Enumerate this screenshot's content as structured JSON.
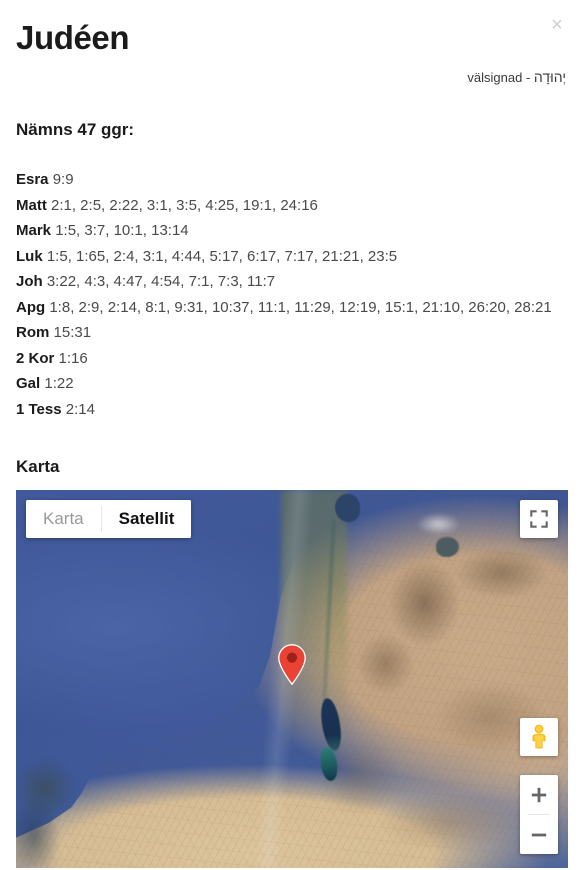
{
  "modal": {
    "close_label": "×"
  },
  "header": {
    "title": "Judéen",
    "hebrew": "יְהוּדָה",
    "separator": " - ",
    "meaning": "välsignad"
  },
  "mentions": {
    "heading": "Nämns 47 ggr:",
    "count": 47,
    "references": [
      {
        "book": "Esra",
        "verses": "9:9"
      },
      {
        "book": "Matt",
        "verses": "2:1, 2:5, 2:22, 3:1, 3:5, 4:25, 19:1, 24:16"
      },
      {
        "book": "Mark",
        "verses": "1:5, 3:7, 10:1, 13:14"
      },
      {
        "book": "Luk",
        "verses": "1:5, 1:65, 2:4, 3:1, 4:44, 5:17, 6:17, 7:17, 21:21, 23:5"
      },
      {
        "book": "Joh",
        "verses": "3:22, 4:3, 4:47, 4:54, 7:1, 7:3, 11:7"
      },
      {
        "book": "Apg",
        "verses": "1:8, 2:9, 2:14, 8:1, 9:31, 10:37, 11:1, 11:29, 12:19, 15:1, 21:10, 26:20, 28:21"
      },
      {
        "book": "Rom",
        "verses": "15:31"
      },
      {
        "book": "2 Kor",
        "verses": "1:16"
      },
      {
        "book": "Gal",
        "verses": "1:22"
      },
      {
        "book": "1 Tess",
        "verses": "2:14"
      }
    ]
  },
  "map": {
    "heading": "Karta",
    "type_control": {
      "map_label": "Karta",
      "satellite_label": "Satellit",
      "selected": "Satellit"
    },
    "controls": {
      "fullscreen_title": "Växla helskärmsvy",
      "pegman_title": "Dra Pegman till kartan för att öppna Street View",
      "zoom_in_label": "+",
      "zoom_out_label": "−"
    },
    "marker": {
      "title": "Judéen",
      "color": "#ea4335"
    },
    "colors": {
      "sea": "#41599b",
      "land": "#c7a888",
      "desert": "#d9c099",
      "dead_sea": "#1d3457"
    }
  }
}
